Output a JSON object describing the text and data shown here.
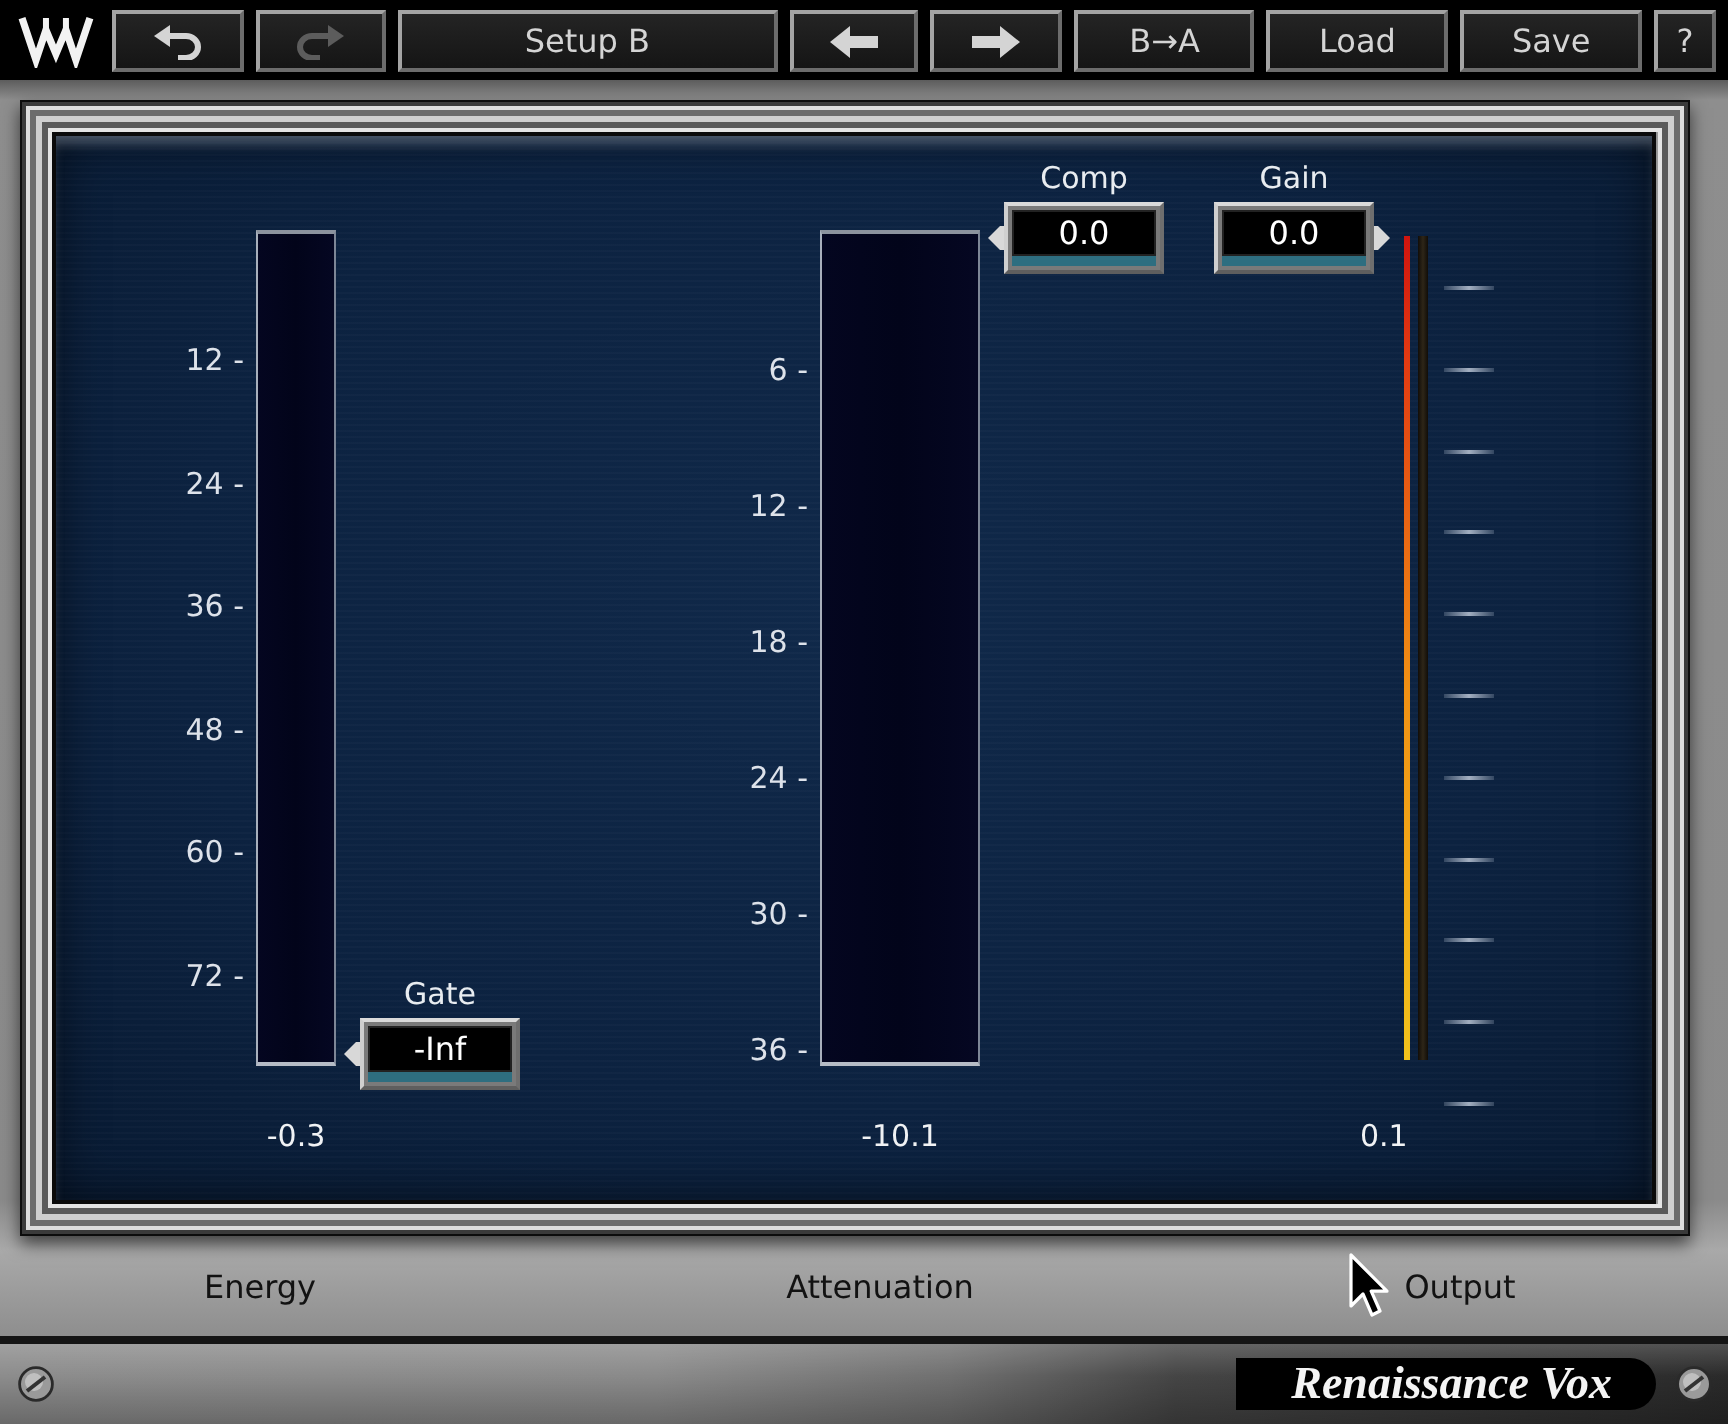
{
  "toolbar": {
    "buttons": [
      {
        "kind": "undo",
        "disabled": false
      },
      {
        "kind": "redo",
        "disabled": true
      },
      {
        "kind": "text",
        "label": "Setup B",
        "disabled": false
      },
      {
        "kind": "back",
        "disabled": false
      },
      {
        "kind": "forward",
        "disabled": false
      },
      {
        "kind": "text",
        "label": "B→A",
        "disabled": false
      },
      {
        "kind": "text",
        "label": "Load",
        "disabled": false
      },
      {
        "kind": "text",
        "label": "Save",
        "disabled": false
      },
      {
        "kind": "text",
        "label": "?",
        "disabled": false
      }
    ]
  },
  "meters": [
    {
      "kind": "bar",
      "scale": [
        "12 -",
        "24 -",
        "36 -",
        "48 -",
        "60 -",
        "72 -"
      ],
      "reading": "-0.3",
      "control": {
        "label": "Gate",
        "value": "-Inf"
      }
    },
    {
      "kind": "bar",
      "scale": [
        "6 -",
        "12 -",
        "18 -",
        "24 -",
        "30 -",
        "36 -"
      ],
      "reading": "-10.1",
      "control": {
        "label": "Comp",
        "value": "0.0"
      }
    },
    {
      "kind": "peak",
      "level": 1,
      "reading": "0.1",
      "control": {
        "label": "Gain",
        "value": "0.0"
      }
    }
  ],
  "meter_titles": [
    "Energy",
    "Attenuation",
    "Output"
  ],
  "product_name": "Renaissance Vox"
}
